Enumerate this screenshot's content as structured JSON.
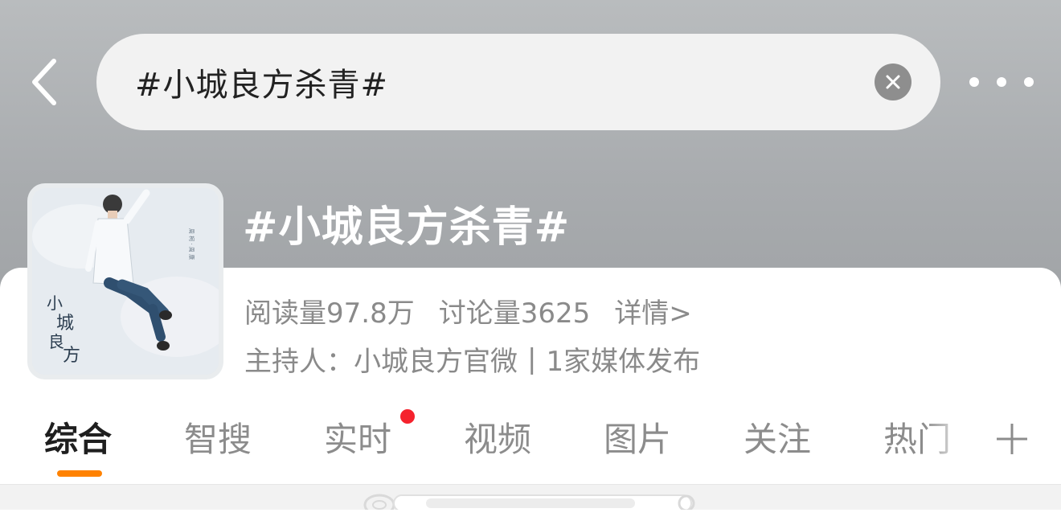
{
  "header": {
    "search_value": "#小城良方杀青#"
  },
  "topic": {
    "title": "#小城良方杀青#",
    "reads": "阅读量97.8万",
    "discussions": "讨论量3625",
    "detail_link": "详情>",
    "host": "主持人：小城良方官微",
    "media": "1家媒体发布",
    "separator": "|"
  },
  "tabs": [
    {
      "label": "综合",
      "active": true
    },
    {
      "label": "智搜"
    },
    {
      "label": "实时",
      "has_dot": true
    },
    {
      "label": "视频"
    },
    {
      "label": "图片"
    },
    {
      "label": "关注"
    },
    {
      "label": "热门"
    }
  ],
  "colors": {
    "accent": "#ff8200",
    "dot": "#f5222d"
  },
  "icons": [
    "back-arrow-icon",
    "clear-icon",
    "more-icon",
    "plus-icon"
  ]
}
